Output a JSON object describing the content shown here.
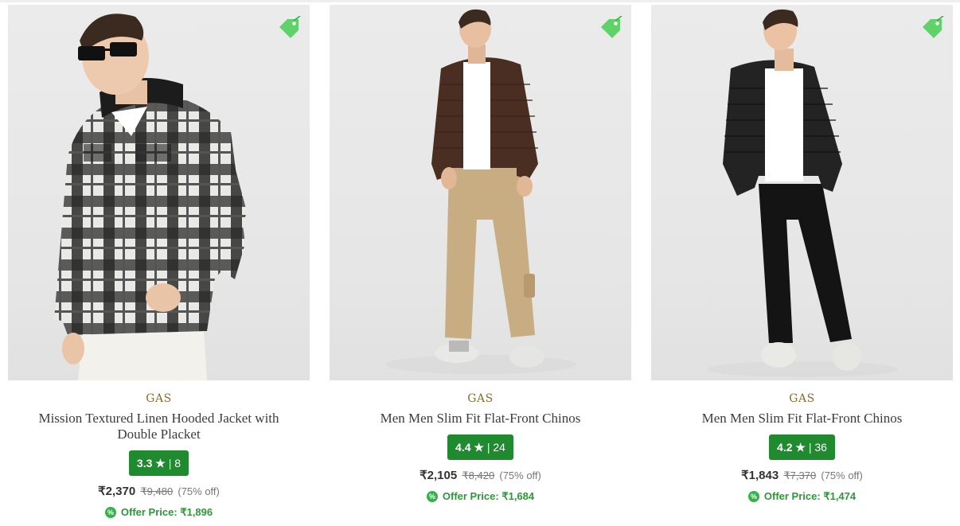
{
  "products": [
    {
      "brand": "GAS",
      "title": "Mission Textured Linen Hooded Jacket with Double Placket",
      "rating": "3.3",
      "star": "★",
      "sep": "|",
      "reviews": "8",
      "price": "₹2,370",
      "mrp": "₹9,480",
      "discount": "(75% off)",
      "offer_label": "Offer Price:",
      "offer_price": "₹1,896",
      "offer_icon": "%"
    },
    {
      "brand": "GAS",
      "title": "Men Men Slim Fit Flat-Front Chinos",
      "rating": "4.4",
      "star": "★",
      "sep": "|",
      "reviews": "24",
      "price": "₹2,105",
      "mrp": "₹8,420",
      "discount": "(75% off)",
      "offer_label": "Offer Price:",
      "offer_price": "₹1,684",
      "offer_icon": "%"
    },
    {
      "brand": "GAS",
      "title": "Men Men Slim Fit Flat-Front Chinos",
      "rating": "4.2",
      "star": "★",
      "sep": "|",
      "reviews": "36",
      "price": "₹1,843",
      "mrp": "₹7,370",
      "discount": "(75% off)",
      "offer_label": "Offer Price:",
      "offer_price": "₹1,474",
      "offer_icon": "%"
    }
  ],
  "colors": {
    "brand": "#8b6d2a",
    "rating_bg": "#1f8a2e",
    "offer": "#2a9a35",
    "tag_icon": "#5fd36a"
  },
  "icons": {
    "tag": "price-tag-icon",
    "offer": "percent-badge-icon"
  }
}
